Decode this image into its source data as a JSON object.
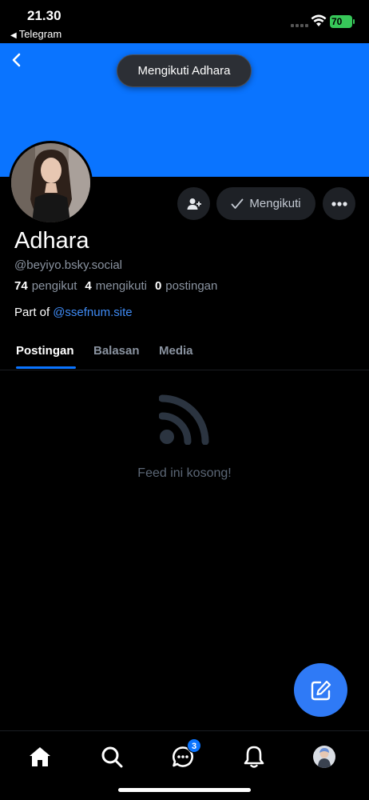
{
  "status_bar": {
    "time": "21.30",
    "back_app": "Telegram",
    "battery": "70"
  },
  "toast": {
    "text": "Mengikuti Adhara"
  },
  "profile": {
    "display_name": "Adhara",
    "handle": "@beyiyo.bsky.social",
    "followers_count": "74",
    "followers_label": "pengikut",
    "following_count": "4",
    "following_label": "mengikuti",
    "posts_count": "0",
    "posts_label": "postingan",
    "part_of_label": "Part of",
    "part_of_link": "@ssefnum.site"
  },
  "actions": {
    "add_user_icon": "person-plus-icon",
    "following_label": "Mengikuti",
    "more_icon": "ellipsis-icon"
  },
  "tabs": [
    {
      "label": "Postingan",
      "active": true
    },
    {
      "label": "Balasan",
      "active": false
    },
    {
      "label": "Media",
      "active": false
    }
  ],
  "feed": {
    "empty_icon": "rss-icon",
    "empty_text": "Feed ini kosong!"
  },
  "fab": {
    "icon": "compose-icon"
  },
  "bottom_nav": {
    "items": [
      {
        "icon": "home-icon"
      },
      {
        "icon": "search-icon"
      },
      {
        "icon": "chat-icon",
        "badge": "3"
      },
      {
        "icon": "bell-icon"
      },
      {
        "icon": "profile-avatar"
      }
    ]
  },
  "colors": {
    "banner": "#0a74ff",
    "accent": "#0a74ff",
    "link": "#3f8bf5",
    "fab": "#2f7af6"
  }
}
